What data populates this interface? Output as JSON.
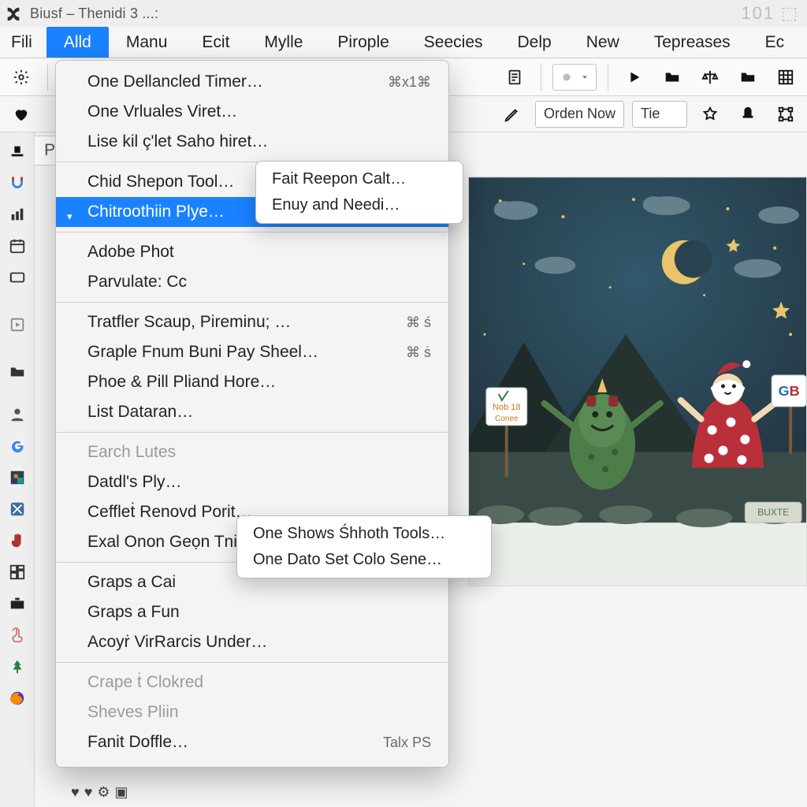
{
  "window": {
    "title": "Biusf – Thenidi 3 ...:",
    "counter": "101 ⬚"
  },
  "menubar": {
    "items": [
      "Fili",
      "Alld",
      "Manu",
      "Ecit",
      "Mylle",
      "Pirople",
      "Seecies",
      "Delp",
      "New",
      "Tepreases",
      "Ec"
    ],
    "active_index": 1
  },
  "toolbar2": {
    "order_label": "Orden Now",
    "tie_label": "Tie"
  },
  "panel": {
    "tab_label": "Pi"
  },
  "popup": {
    "groups": [
      [
        {
          "label": "One Dellancled Timer…",
          "kb": "⌘x1⌘"
        },
        {
          "label": "One Vrluales Viret…"
        },
        {
          "label": "Lise kil ç'let Saho hiret…"
        }
      ],
      [
        {
          "label": "Chid Shepon Tool…"
        },
        {
          "label": "Chitroothiin Plye…",
          "selected": true,
          "has_submenu": true
        }
      ],
      [
        {
          "label": "Adobe Phot"
        },
        {
          "label": "Parvulate: Cc"
        }
      ],
      [
        {
          "label": "Tratfler Scaup, Pireminu; …",
          "kb": "⌘ ś"
        },
        {
          "label": "Graple Fnum Buni Pay Sheel…",
          "kb": "⌘ ṡ"
        },
        {
          "label": "Phoe & Pill Pliand Hore…"
        },
        {
          "label": "List Dataran…"
        }
      ],
      [
        {
          "label": "Earch Lutes",
          "disabled": true
        },
        {
          "label": "Datdl's Ply…"
        },
        {
          "label": "Ceffleṫ Renovd Porit…"
        },
        {
          "label": "Exal Onon Geọn Tnin Shleeding"
        }
      ],
      [
        {
          "label": "Graps a Cai"
        },
        {
          "label": "Graps a Fun"
        },
        {
          "label": "Acoyṙ VirRarcis Under…"
        }
      ],
      [
        {
          "label": "Crape ṫ Clokred",
          "disabled": true
        },
        {
          "label": "Sheves Pliin",
          "disabled": true
        },
        {
          "label": "Fanit Doffle…",
          "kb": "Talx PS"
        }
      ]
    ]
  },
  "submenu1": {
    "items": [
      "Fait Reepon Calt…",
      "Enuy and Needi…"
    ]
  },
  "submenu2": {
    "items": [
      "One Shows Śhhoth Tools…",
      "One Dato Set Colo Sene…"
    ]
  },
  "canvas": {
    "badge1_line1": "Nob 18",
    "badge1_line2": "Conee",
    "badge2": "GB",
    "button": "BUXTE"
  }
}
